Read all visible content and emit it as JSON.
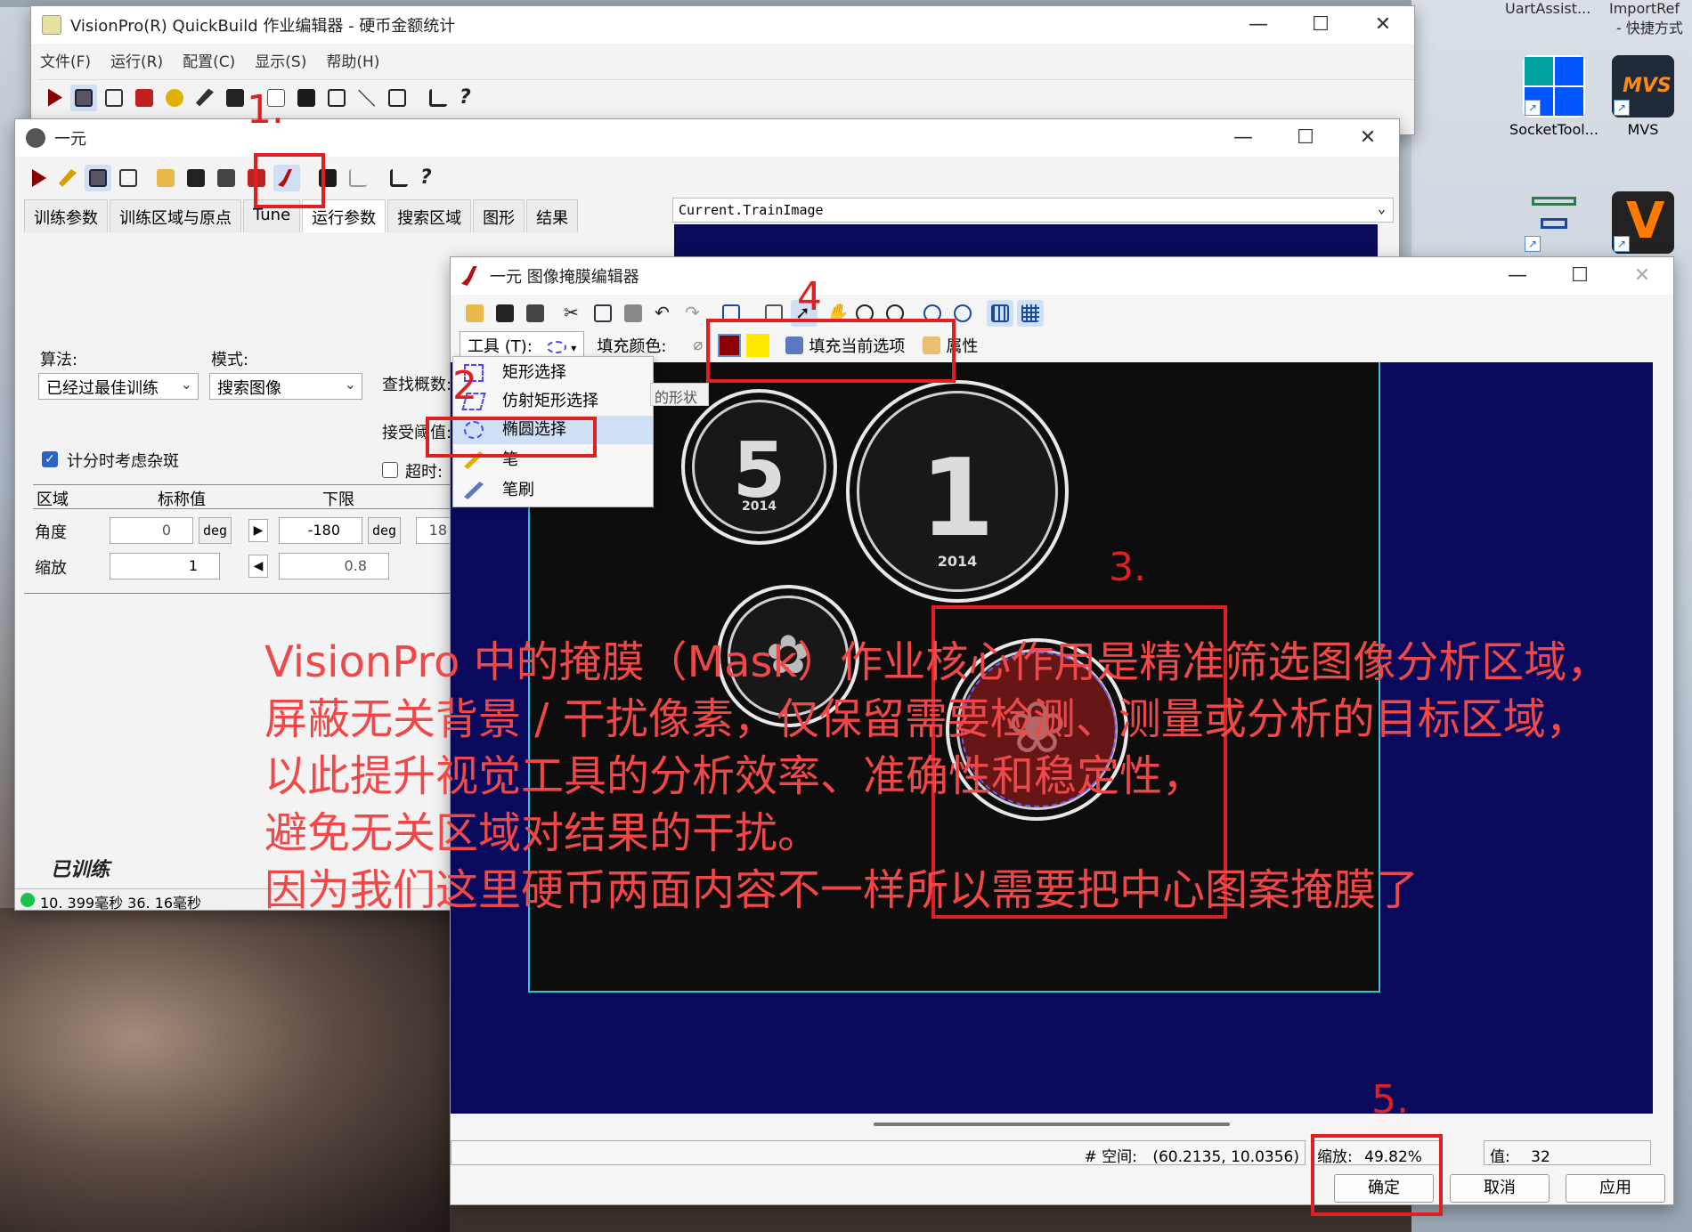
{
  "desktop": {
    "top_labels": [
      "UartAssist...",
      "ImportRef",
      "- 快捷方式"
    ],
    "icons": [
      {
        "label": "SocketTool..."
      },
      {
        "label": "MVS"
      }
    ]
  },
  "main_window": {
    "title": "VisionPro(R) QuickBuild 作业编辑器 - 硬币金额统计",
    "menu": [
      "文件(F)",
      "运行(R)",
      "配置(C)",
      "显示(S)",
      "帮助(H)"
    ],
    "controls": {
      "minimize": "—",
      "maximize": "☐",
      "close": "✕"
    }
  },
  "yiyuan_window": {
    "title": "一元",
    "tabs": [
      "训练参数",
      "训练区域与原点",
      "Tune",
      "运行参数",
      "搜索区域",
      "图形",
      "结果"
    ],
    "algorithm_label": "算法:",
    "algorithm_value": "已经过最佳训练",
    "mode_label": "模式:",
    "mode_value": "搜索图像",
    "find_count_label": "查找概数:",
    "accept_threshold_label": "接受阈值:",
    "timeout_label": "超时:",
    "clutter_label": "计分时考虑杂斑",
    "grid_headers": [
      "区域",
      "标称值",
      "下限",
      "上限"
    ],
    "rows": [
      {
        "name": "角度",
        "nominal": "0",
        "unit": "deg",
        "low": "-180",
        "low_unit": "deg",
        "high": "18"
      },
      {
        "name": "缩放",
        "nominal": "1",
        "low": "0.8"
      }
    ],
    "trained_label": "已训练",
    "status_text": "10. 399毫秒 36. 16毫秒",
    "image_combo": "Current.TrainImage"
  },
  "mask_editor": {
    "title": "一元 图像掩膜编辑器",
    "tool_label": "工具 (T):",
    "fill_color_label": "填充颜色:",
    "fill_current_label": "填充当前选项",
    "properties_label": "属性",
    "tooltip_fragment": "的形状",
    "dropdown_items": [
      "矩形选择",
      "仿射矩形选择",
      "椭圆选择",
      "笔",
      "笔刷"
    ],
    "status": {
      "space_label": "# 空间:",
      "space_value": "(60.2135, 10.0356)",
      "zoom_label": "缩放:",
      "zoom_value": "49.82%",
      "value_label": "值:",
      "value_value": "32"
    },
    "buttons": {
      "ok": "确定",
      "cancel": "取消",
      "apply": "应用"
    },
    "coins": [
      {
        "text": "5",
        "sub": "2014"
      },
      {
        "text": "1",
        "sub": "2014"
      },
      {
        "text": "",
        "sub": ""
      },
      {
        "text": "",
        "sub": ""
      }
    ]
  },
  "annotations": {
    "numbers": [
      "1.",
      "2",
      "3.",
      "4",
      "5."
    ],
    "overlay_lines": [
      "VisionPro 中的掩膜（Mask）作业核心作用是精准筛选图像分析区域，",
      "屏蔽无关背景 / 干扰像素，仅保留需要检测、测量或分析的目标区域，",
      "以此提升视觉工具的分析效率、准确性和稳定性，",
      "避免无关区域对结果的干扰。",
      "因为我们这里硬币两面内容不一样所以需要把中心图案掩膜了"
    ],
    "color": "#e02020"
  },
  "colors": {
    "canvas_bg": "#0a0a5c",
    "fill_dark_red": "#8b0000",
    "fill_yellow": "#ffea00",
    "image_border": "#2ec6d6"
  }
}
